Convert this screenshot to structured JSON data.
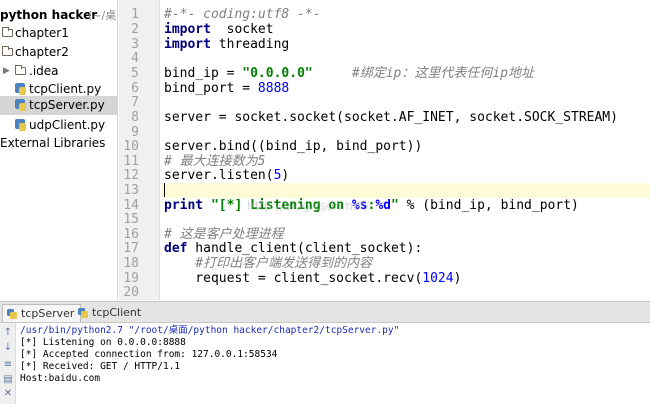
{
  "project": {
    "root_label": "python hacker",
    "root_path": "(~/桌面",
    "items": [
      {
        "label": "chapter1",
        "type": "folder"
      },
      {
        "label": "chapter2",
        "type": "folder"
      },
      {
        "label": ".idea",
        "type": "folder"
      },
      {
        "label": "tcpClient.py",
        "type": "file"
      },
      {
        "label": "tcpServer.py",
        "type": "file",
        "selected": true
      },
      {
        "label": "udpClient.py",
        "type": "file"
      },
      {
        "label": "External Libraries",
        "type": "library"
      }
    ]
  },
  "editor": {
    "line_numbers": [
      "1",
      "2",
      "3",
      "4",
      "5",
      "6",
      "7",
      "8",
      "9",
      "10",
      "11",
      "12",
      "13",
      "14",
      "15",
      "16",
      "17",
      "18",
      "19",
      "20"
    ],
    "current_line": 13,
    "code": {
      "l1": "#-*- coding:utf8 -*-",
      "l2_kw": "import",
      "l2_rest": "  socket",
      "l3_kw": "import",
      "l3_rest": " threading",
      "l5_a": "bind_ip = ",
      "l5_str": "\"0.0.0.0\"",
      "l5_gap": "     ",
      "l5_cmt": "#绑定ip：这里代表任何ip地址",
      "l6_a": "bind_port = ",
      "l6_num": "8888",
      "l8": "server = socket.socket(socket.AF_INET, socket.SOCK_STREAM)",
      "l10": "server.bind((bind_ip, bind_port))",
      "l11": "# 最大连接数为5",
      "l12_a": "server.listen(",
      "l12_num": "5",
      "l12_b": ")",
      "l14_kw": "print",
      "l14_s1": " \"[*] Listening on ",
      "l14_fmt1": "%s",
      "l14_s2": ":",
      "l14_fmt2": "%d",
      "l14_s3": "\"",
      "l14_rest": " % (bind_ip, bind_port)",
      "l16": "# 这是客户处理进程",
      "l17_kw": "def",
      "l17_rest": " handle_client(client_socket):",
      "l18": "    #打印出客户端发送得到的内容",
      "l19_a": "    request = client_socket.recv(",
      "l19_num": "1024",
      "l19_b": ")",
      "l20": ""
    },
    "watermark": "http://blog.csdn.net/"
  },
  "run_tabs": [
    {
      "label": "tcpServer",
      "active": true
    },
    {
      "label": "tcpClient",
      "active": false
    }
  ],
  "console": {
    "lines": [
      "/usr/bin/python2.7 \"/root/桌面/python hacker/chapter2/tcpServer.py\"",
      "[*] Listening on 0.0.0.0:8888",
      "[*] Accepted connection from: 127.0.0.1:58534",
      "[*] Received: GET / HTTP/1.1",
      "Host:baidu.com"
    ]
  },
  "colors": {
    "keyword": "#000080",
    "string": "#008000",
    "number": "#0000ff",
    "comment": "#808080",
    "current_line": "#fffbd6",
    "selection": "#d5d5d5"
  }
}
